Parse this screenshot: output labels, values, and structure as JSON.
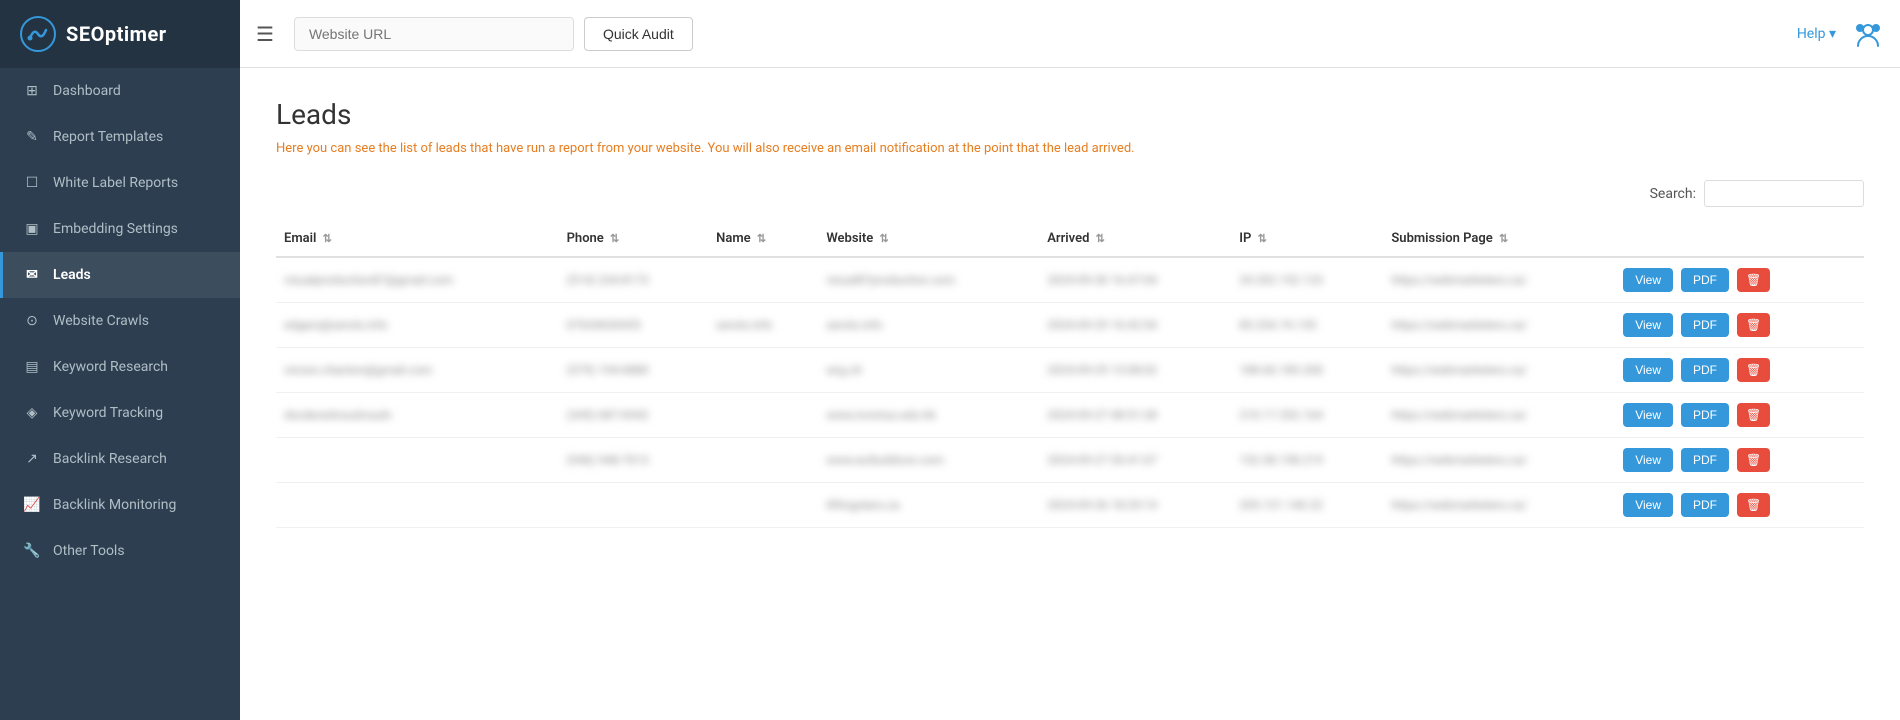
{
  "app": {
    "name": "SEOptimer"
  },
  "header": {
    "url_placeholder": "Website URL",
    "quick_audit_label": "Quick Audit",
    "help_label": "Help ▾",
    "hamburger": "☰"
  },
  "sidebar": {
    "items": [
      {
        "id": "dashboard",
        "label": "Dashboard",
        "icon": "⊞",
        "active": false
      },
      {
        "id": "report-templates",
        "label": "Report Templates",
        "icon": "✎",
        "active": false
      },
      {
        "id": "white-label-reports",
        "label": "White Label Reports",
        "icon": "☐",
        "active": false
      },
      {
        "id": "embedding-settings",
        "label": "Embedding Settings",
        "icon": "▣",
        "active": false
      },
      {
        "id": "leads",
        "label": "Leads",
        "icon": "✉",
        "active": true
      },
      {
        "id": "website-crawls",
        "label": "Website Crawls",
        "icon": "⊙",
        "active": false
      },
      {
        "id": "keyword-research",
        "label": "Keyword Research",
        "icon": "▤",
        "active": false
      },
      {
        "id": "keyword-tracking",
        "label": "Keyword Tracking",
        "icon": "◈",
        "active": false
      },
      {
        "id": "backlink-research",
        "label": "Backlink Research",
        "icon": "↗",
        "active": false
      },
      {
        "id": "backlink-monitoring",
        "label": "Backlink Monitoring",
        "icon": "📈",
        "active": false
      },
      {
        "id": "other-tools",
        "label": "Other Tools",
        "icon": "🔧",
        "active": false
      }
    ]
  },
  "content": {
    "page_title": "Leads",
    "page_description": "Here you can see the list of leads that have run a report from your website. You will also receive an email notification at the point that the lead arrived.",
    "search_label": "Search:",
    "search_placeholder": "",
    "table": {
      "columns": [
        {
          "id": "email",
          "label": "Email"
        },
        {
          "id": "phone",
          "label": "Phone"
        },
        {
          "id": "name",
          "label": "Name"
        },
        {
          "id": "website",
          "label": "Website"
        },
        {
          "id": "arrived",
          "label": "Arrived"
        },
        {
          "id": "ip",
          "label": "IP"
        },
        {
          "id": "submission_page",
          "label": "Submission Page"
        }
      ],
      "rows": [
        {
          "email": "visualproduction87@gmail.com",
          "phone": "(514) 234-8173",
          "name": "",
          "website": "visual87production.com",
          "arrived": "2024-09-30 16:47:04",
          "ip": "24.202.152.123",
          "submission_page": "https://webmarketers.ca/"
        },
        {
          "email": "edgars@serols.info",
          "phone": "07634630435",
          "name": "serols.info",
          "website": "serols.info",
          "arrived": "2024-09-29 16:42:54",
          "ip": "85.254.74.135",
          "submission_page": "https://webmarketers.ca/"
        },
        {
          "email": "vincen.chanton@gmail.com",
          "phone": "(579) 194-6880",
          "name": "",
          "website": "wrg.ch",
          "arrived": "2024-09-29 13:08:02",
          "ip": "188.60.185.200",
          "submission_page": "https://webmarketers.ca/"
        },
        {
          "email": "dscdevedvsudvsudv",
          "phone": "(345) 687-6942",
          "name": "",
          "website": "www.invictus.edu.hk",
          "arrived": "2024-09-27 08:51:28",
          "ip": "210.17.252.164",
          "submission_page": "https://webmarketers.ca/"
        },
        {
          "email": "",
          "phone": "(946) 948-7013",
          "name": "",
          "website": "www.acibuildcon.com",
          "arrived": "2024-09-27 05:41:07",
          "ip": "152.58.198.219",
          "submission_page": "https://webmarketers.ca/"
        },
        {
          "email": "",
          "phone": "",
          "name": "",
          "website": "liftingstars.ca",
          "arrived": "2024-09-26 18:29:14",
          "ip": "205.121.140.22",
          "submission_page": "https://webmarketers.ca/"
        }
      ],
      "btn_view": "View",
      "btn_pdf": "PDF",
      "btn_delete": "🗑"
    }
  },
  "colors": {
    "sidebar_bg": "#2c3e50",
    "accent_blue": "#3498db",
    "accent_red": "#e74c3c",
    "active_border": "#3498db"
  }
}
